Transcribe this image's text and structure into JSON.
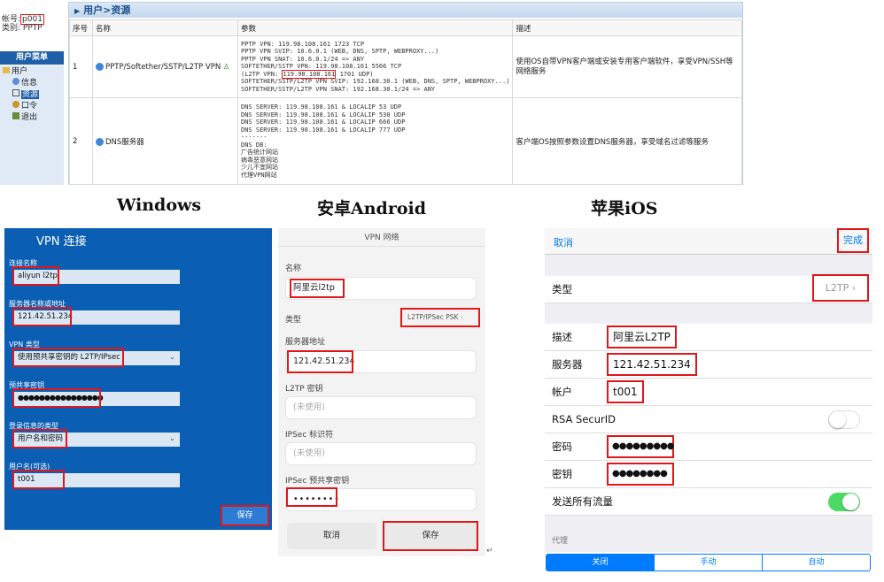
{
  "top": {
    "account_label": "帐号:",
    "account_value": "p001",
    "type_label": "类别: PPTP",
    "menu_title": "用户菜单",
    "tree": [
      "用户",
      "信息",
      "资源",
      "口令",
      "退出"
    ],
    "window_title": "用户>资源",
    "columns": [
      "序号",
      "名称",
      "参数",
      "描述"
    ],
    "rows": [
      {
        "index": "1",
        "name": "PPTP/Softether/SSTP/L2TP VPN",
        "params": [
          "PPTP VPN: 119.98.108.161 1723 TCP",
          "PPTP VPN SVIP: 10.6.0.1 (WEB, DNS, SPTP, WEBPROXY...)",
          "PPTP VPN SNAT: 10.6.0.1/24 => ANY",
          "SOFTETHER/SSTP VPN: 119.98.108.161 5566 TCP"
        ],
        "params_l2tp_prefix": "(L2TP VPN: ",
        "params_l2tp_highlight": "119.98.108.161",
        "params_l2tp_suffix": " 1701 UDP)",
        "params_tail": [
          "SOFTETHER/SSTP/L2TP VPN SVIP: 192.168.30.1 (WEB, DNS, SPTP, WEBPROXY...)",
          "SOFTETHER/SSTP/L2TP VPN SNAT: 192.168.30.1/24 => ANY"
        ],
        "desc": "使用OS自带VPN客户端或安装专用客户端软件，享受VPN/SSH等网络服务"
      },
      {
        "index": "2",
        "name": "DNS服务器",
        "params": [
          "DNS SERVER: 119.98.108.161 & LOCALIP 53 UDP",
          "DNS SERVER: 119.98.108.161 & LOCALIP 530 UDP",
          "DNS SERVER: 119.98.108.161 & LOCALIP 666 UDP",
          "DNS SERVER: 119.98.108.161 & LOCALIP 777 UDP",
          "-------",
          "DNS DB:",
          "广告统计网站",
          "病毒恶意网站",
          "少儿不宜网站",
          "代理VPN网站"
        ],
        "desc": "客户端OS按照参数设置DNS服务器，享受域名过滤等服务"
      }
    ]
  },
  "headings": {
    "windows": "Windows",
    "android": "安卓Android",
    "ios": "苹果iOS"
  },
  "windows": {
    "title": "VPN 连接",
    "conn_name_label": "连接名称",
    "conn_name": "aliyun l2tp",
    "server_label": "服务器名称或地址",
    "server": "121.42.51.234",
    "type_label": "VPN 类型",
    "type": "使用预共享密钥的 L2TP/IPsec",
    "psk_label": "预共享密钥",
    "psk": "●●●●●●●●●●●●●●●●",
    "login_type_label": "登录信息的类型",
    "login_type": "用户名和密码",
    "username_label": "用户名(可选)",
    "username": "t001",
    "save": "保存"
  },
  "android": {
    "title": "VPN 网络",
    "name_label": "名称",
    "name": "阿里云l2tp",
    "type_label": "类型",
    "type": "L2TP/IPSec PSK",
    "server_label": "服务器地址",
    "server": "121.42.51.234",
    "l2tp_secret_label": "L2TP 密钥",
    "l2tp_secret_placeholder": "(未使用)",
    "ipsec_id_label": "IPSec 标识符",
    "ipsec_id_placeholder": "(未使用)",
    "ipsec_psk_label": "IPSec 预共享密钥",
    "ipsec_psk": "••••••••",
    "cancel": "取消",
    "save": "保存"
  },
  "ios": {
    "cancel": "取消",
    "done": "完成",
    "type_label": "类型",
    "type": "L2TP",
    "desc_label": "描述",
    "desc": "阿里云L2TP",
    "server_label": "服务器",
    "server": "121.42.51.234",
    "account_label": "帐户",
    "account": "t001",
    "rsa_label": "RSA SecurID",
    "rsa_on": false,
    "password_label": "密码",
    "password": "●●●●●●●●●",
    "secret_label": "密钥",
    "secret": "●●●●●●●●",
    "send_all_label": "发送所有流量",
    "send_all_on": true,
    "proxy_label": "代理",
    "proxy_options": [
      "关闭",
      "手动",
      "自动"
    ],
    "proxy_selected": "关闭",
    "accent": "#007aff",
    "switch_on_color": "#4cd964"
  }
}
